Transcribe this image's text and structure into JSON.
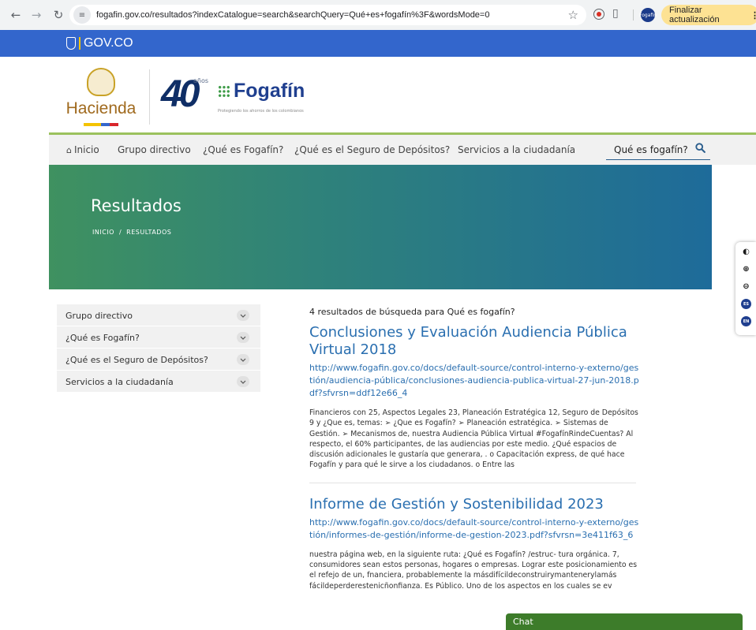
{
  "browser": {
    "url": "fogafin.gov.co/resultados?indexCatalogue=search&searchQuery=Qué+es+fogafín%3F&wordsMode=0",
    "update_button": "Finalizar actualización",
    "profile_label": "Fogafin"
  },
  "govbar": {
    "label": "GOV.CO"
  },
  "header": {
    "hacienda_label": "Hacienda",
    "fogafin_number": "40",
    "fogafin_years": "años",
    "fogafin_name": "Fogafín",
    "fogafin_tagline": "Protegiendo los ahorros de los colombianos"
  },
  "nav": {
    "items": [
      "Inicio",
      "Grupo directivo",
      "¿Qué es Fogafín?",
      "¿Qué es el Seguro de Depósitos?",
      "Servicios a la ciudadanía"
    ],
    "search_value": "Qué es fogafín?"
  },
  "hero": {
    "title": "Resultados",
    "breadcrumb": [
      "INICIO",
      "RESULTADOS"
    ]
  },
  "accessibility": {
    "lang_es": "ES",
    "lang_en": "EN"
  },
  "sidebar": {
    "items": [
      {
        "label": "Grupo directivo"
      },
      {
        "label": "¿Qué es Fogafín?"
      },
      {
        "label": "¿Qué es el Seguro de Depósitos?"
      },
      {
        "label": "Servicios a la ciudadanía"
      }
    ]
  },
  "results": {
    "count_text": "4 resultados de búsqueda para Qué es fogafín?",
    "items": [
      {
        "title": "Conclusiones y Evaluación Audiencia Pública Virtual 2018",
        "url": "http://www.fogafin.gov.co/docs/default-source/control-interno-y-externo/gestión/audiencia-pública/conclusiones-audiencia-publica-virtual-27-jun-2018.pdf?sfvrsn=ddf12e66_4",
        "snippet": "Financieros con 25, Aspectos Legales 23, Planeación Estratégica 12, Seguro de Depósitos 9 y ¿Que es, temas: ➢ ¿Que es Fogafín? ➢ Planeación estratégica. ➢ Sistemas de Gestión. ➢ Mecanismos de, nuestra Audiencia Pública Virtual #FogafínRindeCuentas? Al respecto, el 60% participantes, de las audiencias por este medio. ¿Qué espacios de discusión adicionales le gustaría que generara, . o Capacitación express, de qué hace Fogafín y para qué le sirve a los ciudadanos. o Entre las"
      },
      {
        "title": "Informe de Gestión y Sostenibilidad 2023",
        "url": "http://www.fogafin.gov.co/docs/default-source/control-interno-y-externo/gestión/informes-de-gestión/informe-de-gestion-2023.pdf?sfvrsn=3e411f63_6",
        "snippet": "nuestra página web, en la siguiente ruta: ¿Qué es Fogafín? /estruc- tura orgánica. 7, consumidores sean estos personas, hogares o empresas. Lograr este posicionamiento es el refejo de un, fnanciera, probablemente la másdifícildeconstruirymantenerylamás fácildeperderestenicñonfianza. Es Público. Uno de los aspectos en los cuales se ev"
      }
    ]
  },
  "chat": {
    "label": "Chat"
  }
}
